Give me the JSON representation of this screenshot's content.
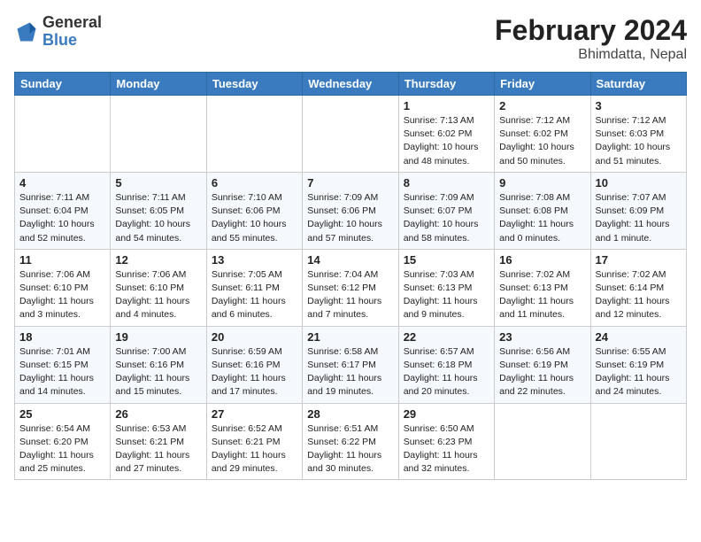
{
  "logo": {
    "line1": "General",
    "line2": "Blue"
  },
  "title": "February 2024",
  "subtitle": "Bhimdatta, Nepal",
  "days": [
    "Sunday",
    "Monday",
    "Tuesday",
    "Wednesday",
    "Thursday",
    "Friday",
    "Saturday"
  ],
  "weeks": [
    [
      {
        "day": "",
        "info": ""
      },
      {
        "day": "",
        "info": ""
      },
      {
        "day": "",
        "info": ""
      },
      {
        "day": "",
        "info": ""
      },
      {
        "day": "1",
        "info": "Sunrise: 7:13 AM\nSunset: 6:02 PM\nDaylight: 10 hours\nand 48 minutes."
      },
      {
        "day": "2",
        "info": "Sunrise: 7:12 AM\nSunset: 6:02 PM\nDaylight: 10 hours\nand 50 minutes."
      },
      {
        "day": "3",
        "info": "Sunrise: 7:12 AM\nSunset: 6:03 PM\nDaylight: 10 hours\nand 51 minutes."
      }
    ],
    [
      {
        "day": "4",
        "info": "Sunrise: 7:11 AM\nSunset: 6:04 PM\nDaylight: 10 hours\nand 52 minutes."
      },
      {
        "day": "5",
        "info": "Sunrise: 7:11 AM\nSunset: 6:05 PM\nDaylight: 10 hours\nand 54 minutes."
      },
      {
        "day": "6",
        "info": "Sunrise: 7:10 AM\nSunset: 6:06 PM\nDaylight: 10 hours\nand 55 minutes."
      },
      {
        "day": "7",
        "info": "Sunrise: 7:09 AM\nSunset: 6:06 PM\nDaylight: 10 hours\nand 57 minutes."
      },
      {
        "day": "8",
        "info": "Sunrise: 7:09 AM\nSunset: 6:07 PM\nDaylight: 10 hours\nand 58 minutes."
      },
      {
        "day": "9",
        "info": "Sunrise: 7:08 AM\nSunset: 6:08 PM\nDaylight: 11 hours\nand 0 minutes."
      },
      {
        "day": "10",
        "info": "Sunrise: 7:07 AM\nSunset: 6:09 PM\nDaylight: 11 hours\nand 1 minute."
      }
    ],
    [
      {
        "day": "11",
        "info": "Sunrise: 7:06 AM\nSunset: 6:10 PM\nDaylight: 11 hours\nand 3 minutes."
      },
      {
        "day": "12",
        "info": "Sunrise: 7:06 AM\nSunset: 6:10 PM\nDaylight: 11 hours\nand 4 minutes."
      },
      {
        "day": "13",
        "info": "Sunrise: 7:05 AM\nSunset: 6:11 PM\nDaylight: 11 hours\nand 6 minutes."
      },
      {
        "day": "14",
        "info": "Sunrise: 7:04 AM\nSunset: 6:12 PM\nDaylight: 11 hours\nand 7 minutes."
      },
      {
        "day": "15",
        "info": "Sunrise: 7:03 AM\nSunset: 6:13 PM\nDaylight: 11 hours\nand 9 minutes."
      },
      {
        "day": "16",
        "info": "Sunrise: 7:02 AM\nSunset: 6:13 PM\nDaylight: 11 hours\nand 11 minutes."
      },
      {
        "day": "17",
        "info": "Sunrise: 7:02 AM\nSunset: 6:14 PM\nDaylight: 11 hours\nand 12 minutes."
      }
    ],
    [
      {
        "day": "18",
        "info": "Sunrise: 7:01 AM\nSunset: 6:15 PM\nDaylight: 11 hours\nand 14 minutes."
      },
      {
        "day": "19",
        "info": "Sunrise: 7:00 AM\nSunset: 6:16 PM\nDaylight: 11 hours\nand 15 minutes."
      },
      {
        "day": "20",
        "info": "Sunrise: 6:59 AM\nSunset: 6:16 PM\nDaylight: 11 hours\nand 17 minutes."
      },
      {
        "day": "21",
        "info": "Sunrise: 6:58 AM\nSunset: 6:17 PM\nDaylight: 11 hours\nand 19 minutes."
      },
      {
        "day": "22",
        "info": "Sunrise: 6:57 AM\nSunset: 6:18 PM\nDaylight: 11 hours\nand 20 minutes."
      },
      {
        "day": "23",
        "info": "Sunrise: 6:56 AM\nSunset: 6:19 PM\nDaylight: 11 hours\nand 22 minutes."
      },
      {
        "day": "24",
        "info": "Sunrise: 6:55 AM\nSunset: 6:19 PM\nDaylight: 11 hours\nand 24 minutes."
      }
    ],
    [
      {
        "day": "25",
        "info": "Sunrise: 6:54 AM\nSunset: 6:20 PM\nDaylight: 11 hours\nand 25 minutes."
      },
      {
        "day": "26",
        "info": "Sunrise: 6:53 AM\nSunset: 6:21 PM\nDaylight: 11 hours\nand 27 minutes."
      },
      {
        "day": "27",
        "info": "Sunrise: 6:52 AM\nSunset: 6:21 PM\nDaylight: 11 hours\nand 29 minutes."
      },
      {
        "day": "28",
        "info": "Sunrise: 6:51 AM\nSunset: 6:22 PM\nDaylight: 11 hours\nand 30 minutes."
      },
      {
        "day": "29",
        "info": "Sunrise: 6:50 AM\nSunset: 6:23 PM\nDaylight: 11 hours\nand 32 minutes."
      },
      {
        "day": "",
        "info": ""
      },
      {
        "day": "",
        "info": ""
      }
    ]
  ]
}
